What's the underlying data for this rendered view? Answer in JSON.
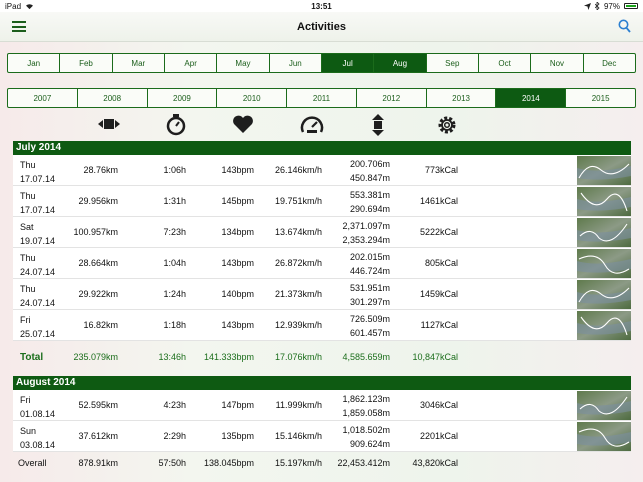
{
  "status": {
    "device": "iPad",
    "time": "13:51",
    "battery": "97%"
  },
  "nav": {
    "title": "Activities"
  },
  "months": {
    "items": [
      "Jan",
      "Feb",
      "Mar",
      "Apr",
      "May",
      "Jun",
      "Jul",
      "Aug",
      "Sep",
      "Oct",
      "Nov",
      "Dec"
    ],
    "selected": [
      "Jul",
      "Aug"
    ]
  },
  "years": {
    "items": [
      "2007",
      "2008",
      "2009",
      "2010",
      "2011",
      "2012",
      "2013",
      "2014",
      "2015"
    ],
    "selected": "2014"
  },
  "column_icons": [
    "distance-icon",
    "stopwatch-icon",
    "heart-icon",
    "speedometer-icon",
    "elevation-icon",
    "gear-icon"
  ],
  "sections": [
    {
      "title": "July 2014",
      "rows": [
        {
          "day": "Thu",
          "date": "17.07.14",
          "distance": "28.76km",
          "time": "1:06h",
          "bpm": "143bpm",
          "speed": "26.146km/h",
          "elev_up": "200.706m",
          "elev_down": "450.847m",
          "cal": "773kCal"
        },
        {
          "day": "Thu",
          "date": "17.07.14",
          "distance": "29.956km",
          "time": "1:31h",
          "bpm": "145bpm",
          "speed": "19.751km/h",
          "elev_up": "553.381m",
          "elev_down": "290.694m",
          "cal": "1461kCal"
        },
        {
          "day": "Sat",
          "date": "19.07.14",
          "distance": "100.957km",
          "time": "7:23h",
          "bpm": "134bpm",
          "speed": "13.674km/h",
          "elev_up": "2,371.097m",
          "elev_down": "2,353.294m",
          "cal": "5222kCal"
        },
        {
          "day": "Thu",
          "date": "24.07.14",
          "distance": "28.664km",
          "time": "1:04h",
          "bpm": "143bpm",
          "speed": "26.872km/h",
          "elev_up": "202.015m",
          "elev_down": "446.724m",
          "cal": "805kCal"
        },
        {
          "day": "Thu",
          "date": "24.07.14",
          "distance": "29.922km",
          "time": "1:24h",
          "bpm": "140bpm",
          "speed": "21.373km/h",
          "elev_up": "531.951m",
          "elev_down": "301.297m",
          "cal": "1459kCal"
        },
        {
          "day": "Fri",
          "date": "25.07.14",
          "distance": "16.82km",
          "time": "1:18h",
          "bpm": "143bpm",
          "speed": "12.939km/h",
          "elev_up": "726.509m",
          "elev_down": "601.457m",
          "cal": "1127kCal"
        }
      ],
      "total": {
        "label": "Total",
        "distance": "235.079km",
        "time": "13:46h",
        "bpm": "141.333bpm",
        "speed": "17.076km/h",
        "elev": "4,585.659m",
        "cal": "10,847kCal"
      }
    },
    {
      "title": "August 2014",
      "rows": [
        {
          "day": "Fri",
          "date": "01.08.14",
          "distance": "52.595km",
          "time": "4:23h",
          "bpm": "147bpm",
          "speed": "11.999km/h",
          "elev_up": "1,862.123m",
          "elev_down": "1,859.058m",
          "cal": "3046kCal"
        },
        {
          "day": "Sun",
          "date": "03.08.14",
          "distance": "37.612km",
          "time": "2:29h",
          "bpm": "135bpm",
          "speed": "15.146km/h",
          "elev_up": "1,018.502m",
          "elev_down": "909.624m",
          "cal": "2201kCal"
        }
      ]
    }
  ],
  "overall": {
    "label": "Overall",
    "distance": "878.91km",
    "time": "57:50h",
    "bpm": "138.045bpm",
    "speed": "15.197km/h",
    "elev": "22,453.412m",
    "cal": "43,820kCal"
  }
}
